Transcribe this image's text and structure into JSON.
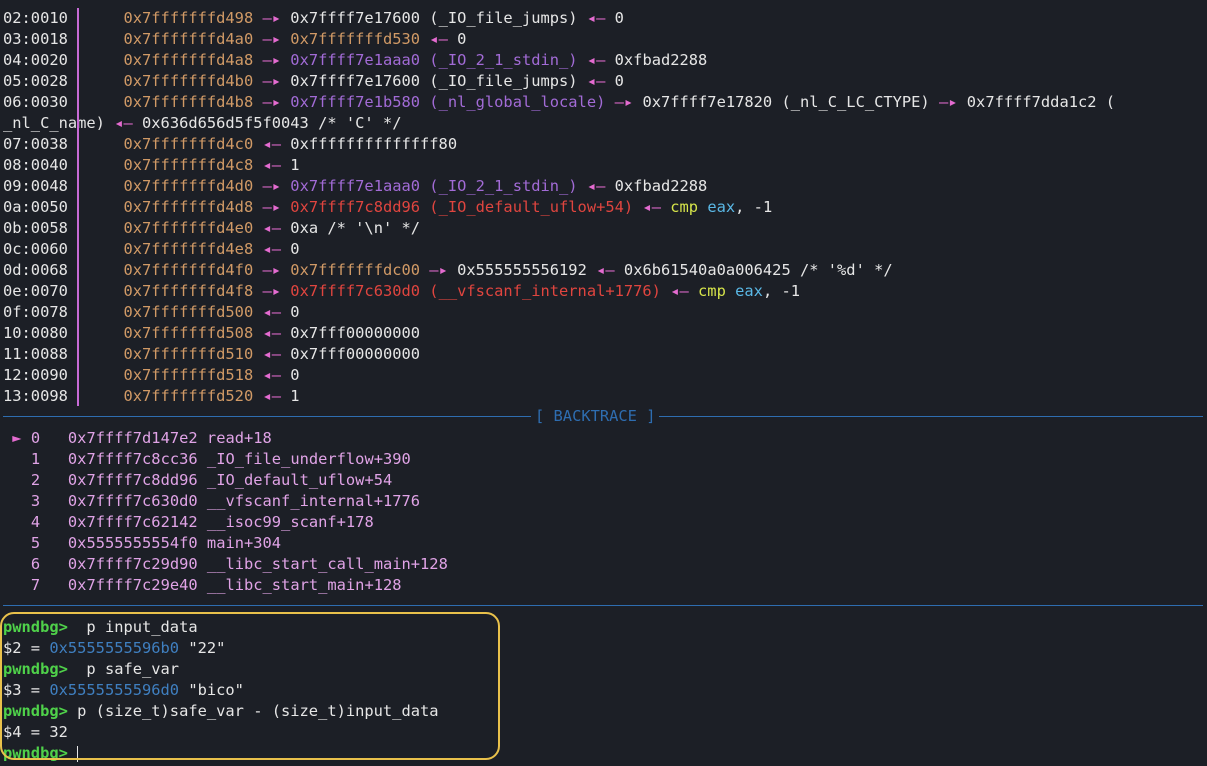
{
  "stack": [
    {
      "off": "02:0010",
      "addr": "0x7fffffffd498",
      "parts": [
        {
          "t": " —▸ ",
          "c": "arrow"
        },
        {
          "t": "0x7ffff7e17600",
          "c": "val"
        },
        {
          "t": " (_IO_file_jumps)",
          "c": "val"
        },
        {
          "t": " ◂— ",
          "c": "arrow"
        },
        {
          "t": "0",
          "c": "val"
        }
      ]
    },
    {
      "off": "03:0018",
      "addr": "0x7fffffffd4a0",
      "parts": [
        {
          "t": " —▸ ",
          "c": "arrow"
        },
        {
          "t": "0x7fffffffd530",
          "c": "addr"
        },
        {
          "t": " ◂— ",
          "c": "arrow"
        },
        {
          "t": "0",
          "c": "val"
        }
      ]
    },
    {
      "off": "04:0020",
      "addr": "0x7fffffffd4a8",
      "parts": [
        {
          "t": " —▸ ",
          "c": "arrow"
        },
        {
          "t": "0x7ffff7e1aaa0",
          "c": "purple"
        },
        {
          "t": " (_IO_2_1_stdin_)",
          "c": "purple"
        },
        {
          "t": " ◂— ",
          "c": "arrow"
        },
        {
          "t": "0xfbad2288",
          "c": "val"
        }
      ]
    },
    {
      "off": "05:0028",
      "addr": "0x7fffffffd4b0",
      "parts": [
        {
          "t": " —▸ ",
          "c": "arrow"
        },
        {
          "t": "0x7ffff7e17600",
          "c": "val"
        },
        {
          "t": " (_IO_file_jumps)",
          "c": "val"
        },
        {
          "t": " ◂— ",
          "c": "arrow"
        },
        {
          "t": "0",
          "c": "val"
        }
      ]
    },
    {
      "off": "06:0030",
      "addr": "0x7fffffffd4b8",
      "parts": [
        {
          "t": " —▸ ",
          "c": "arrow"
        },
        {
          "t": "0x7ffff7e1b580",
          "c": "purple"
        },
        {
          "t": " (_nl_global_locale)",
          "c": "purple"
        },
        {
          "t": " —▸ ",
          "c": "arrow"
        },
        {
          "t": "0x7ffff7e17820",
          "c": "val"
        },
        {
          "t": " (_nl_C_LC_CTYPE)",
          "c": "val"
        },
        {
          "t": " —▸ ",
          "c": "arrow"
        },
        {
          "t": "0x7ffff7dda1c2 (",
          "c": "val"
        }
      ]
    },
    {
      "off": "",
      "addr": "",
      "wrap": true,
      "parts": [
        {
          "t": "_nl_C_name)",
          "c": "val"
        },
        {
          "t": " ◂— ",
          "c": "arrow"
        },
        {
          "t": "0x636d656d5f5f0043 /* 'C' */",
          "c": "val"
        }
      ]
    },
    {
      "off": "07:0038",
      "addr": "0x7fffffffd4c0",
      "parts": [
        {
          "t": " ◂— ",
          "c": "arrow"
        },
        {
          "t": "0xffffffffffffff80",
          "c": "val"
        }
      ]
    },
    {
      "off": "08:0040",
      "addr": "0x7fffffffd4c8",
      "parts": [
        {
          "t": " ◂— ",
          "c": "arrow"
        },
        {
          "t": "1",
          "c": "val"
        }
      ]
    },
    {
      "off": "09:0048",
      "addr": "0x7fffffffd4d0",
      "parts": [
        {
          "t": " —▸ ",
          "c": "arrow"
        },
        {
          "t": "0x7ffff7e1aaa0",
          "c": "purple"
        },
        {
          "t": " (_IO_2_1_stdin_)",
          "c": "purple"
        },
        {
          "t": " ◂— ",
          "c": "arrow"
        },
        {
          "t": "0xfbad2288",
          "c": "val"
        }
      ]
    },
    {
      "off": "0a:0050",
      "addr": "0x7fffffffd4d8",
      "parts": [
        {
          "t": " —▸ ",
          "c": "arrow"
        },
        {
          "t": "0x7ffff7c8dd96",
          "c": "red"
        },
        {
          "t": " (_IO_default_uflow+54)",
          "c": "red"
        },
        {
          "t": " ◂— ",
          "c": "arrow"
        },
        {
          "t": "cmp",
          "c": "kw"
        },
        {
          "t": " ",
          "c": "val"
        },
        {
          "t": "eax",
          "c": "reg"
        },
        {
          "t": ", -1",
          "c": "val"
        }
      ]
    },
    {
      "off": "0b:0058",
      "addr": "0x7fffffffd4e0",
      "parts": [
        {
          "t": " ◂— ",
          "c": "arrow"
        },
        {
          "t": "0xa /* '\\n' */",
          "c": "val"
        }
      ]
    },
    {
      "off": "0c:0060",
      "addr": "0x7fffffffd4e8",
      "parts": [
        {
          "t": " ◂— ",
          "c": "arrow"
        },
        {
          "t": "0",
          "c": "val"
        }
      ]
    },
    {
      "off": "0d:0068",
      "addr": "0x7fffffffd4f0",
      "parts": [
        {
          "t": " —▸ ",
          "c": "arrow"
        },
        {
          "t": "0x7fffffffdc00",
          "c": "addr"
        },
        {
          "t": " —▸ ",
          "c": "arrow"
        },
        {
          "t": "0x555555556192",
          "c": "val"
        },
        {
          "t": " ◂— ",
          "c": "arrow"
        },
        {
          "t": "0x6b61540a0a006425 /* '%d' */",
          "c": "val"
        }
      ]
    },
    {
      "off": "0e:0070",
      "addr": "0x7fffffffd4f8",
      "parts": [
        {
          "t": " —▸ ",
          "c": "arrow"
        },
        {
          "t": "0x7ffff7c630d0",
          "c": "red"
        },
        {
          "t": " (__vfscanf_internal+1776)",
          "c": "red"
        },
        {
          "t": " ◂— ",
          "c": "arrow"
        },
        {
          "t": "cmp",
          "c": "kw"
        },
        {
          "t": " ",
          "c": "val"
        },
        {
          "t": "eax",
          "c": "reg"
        },
        {
          "t": ", -1",
          "c": "val"
        }
      ]
    },
    {
      "off": "0f:0078",
      "addr": "0x7fffffffd500",
      "parts": [
        {
          "t": " ◂— ",
          "c": "arrow"
        },
        {
          "t": "0",
          "c": "val"
        }
      ]
    },
    {
      "off": "10:0080",
      "addr": "0x7fffffffd508",
      "parts": [
        {
          "t": " ◂— ",
          "c": "arrow"
        },
        {
          "t": "0x7fff00000000",
          "c": "val"
        }
      ]
    },
    {
      "off": "11:0088",
      "addr": "0x7fffffffd510",
      "parts": [
        {
          "t": " ◂— ",
          "c": "arrow"
        },
        {
          "t": "0x7fff00000000",
          "c": "val"
        }
      ]
    },
    {
      "off": "12:0090",
      "addr": "0x7fffffffd518",
      "parts": [
        {
          "t": " ◂— ",
          "c": "arrow"
        },
        {
          "t": "0",
          "c": "val"
        }
      ]
    },
    {
      "off": "13:0098",
      "addr": "0x7fffffffd520",
      "parts": [
        {
          "t": " ◂— ",
          "c": "arrow"
        },
        {
          "t": "1",
          "c": "val"
        }
      ]
    }
  ],
  "backtrace_label": "[ BACKTRACE ]",
  "backtrace": [
    {
      "marker": "►",
      "idx": "0",
      "addr": "0x7ffff7d147e2",
      "sym": "read+18"
    },
    {
      "marker": "",
      "idx": "1",
      "addr": "0x7ffff7c8cc36",
      "sym": "_IO_file_underflow+390"
    },
    {
      "marker": "",
      "idx": "2",
      "addr": "0x7ffff7c8dd96",
      "sym": "_IO_default_uflow+54"
    },
    {
      "marker": "",
      "idx": "3",
      "addr": "0x7ffff7c630d0",
      "sym": "__vfscanf_internal+1776"
    },
    {
      "marker": "",
      "idx": "4",
      "addr": "0x7ffff7c62142",
      "sym": "__isoc99_scanf+178"
    },
    {
      "marker": "",
      "idx": "5",
      "addr": "0x5555555554f0",
      "sym": "main+304"
    },
    {
      "marker": "",
      "idx": "6",
      "addr": "0x7ffff7c29d90",
      "sym": "__libc_start_call_main+128"
    },
    {
      "marker": "",
      "idx": "7",
      "addr": "0x7ffff7c29e40",
      "sym": "__libc_start_main+128"
    }
  ],
  "console": [
    {
      "type": "cmd",
      "prompt": "pwndbg>",
      "text": "  p input_data"
    },
    {
      "type": "out",
      "var": "$2 = ",
      "ptr": "0x5555555596b0",
      "str": " \"22\""
    },
    {
      "type": "cmd",
      "prompt": "pwndbg>",
      "text": "  p safe_var"
    },
    {
      "type": "out",
      "var": "$3 = ",
      "ptr": "0x5555555596d0",
      "str": " \"bico\""
    },
    {
      "type": "cmd",
      "prompt": "pwndbg>",
      "text": " p (size_t)safe_var - (size_t)input_data"
    },
    {
      "type": "out",
      "var": "$4 = 32",
      "ptr": "",
      "str": ""
    },
    {
      "type": "cmd",
      "prompt": "pwndbg>",
      "text": " ",
      "cursor": true
    }
  ],
  "colors": {
    "background": "#1c1f26",
    "separator": "#2e6db0",
    "highlight_border": "#e9c14b",
    "prompt": "#4fd14a"
  }
}
